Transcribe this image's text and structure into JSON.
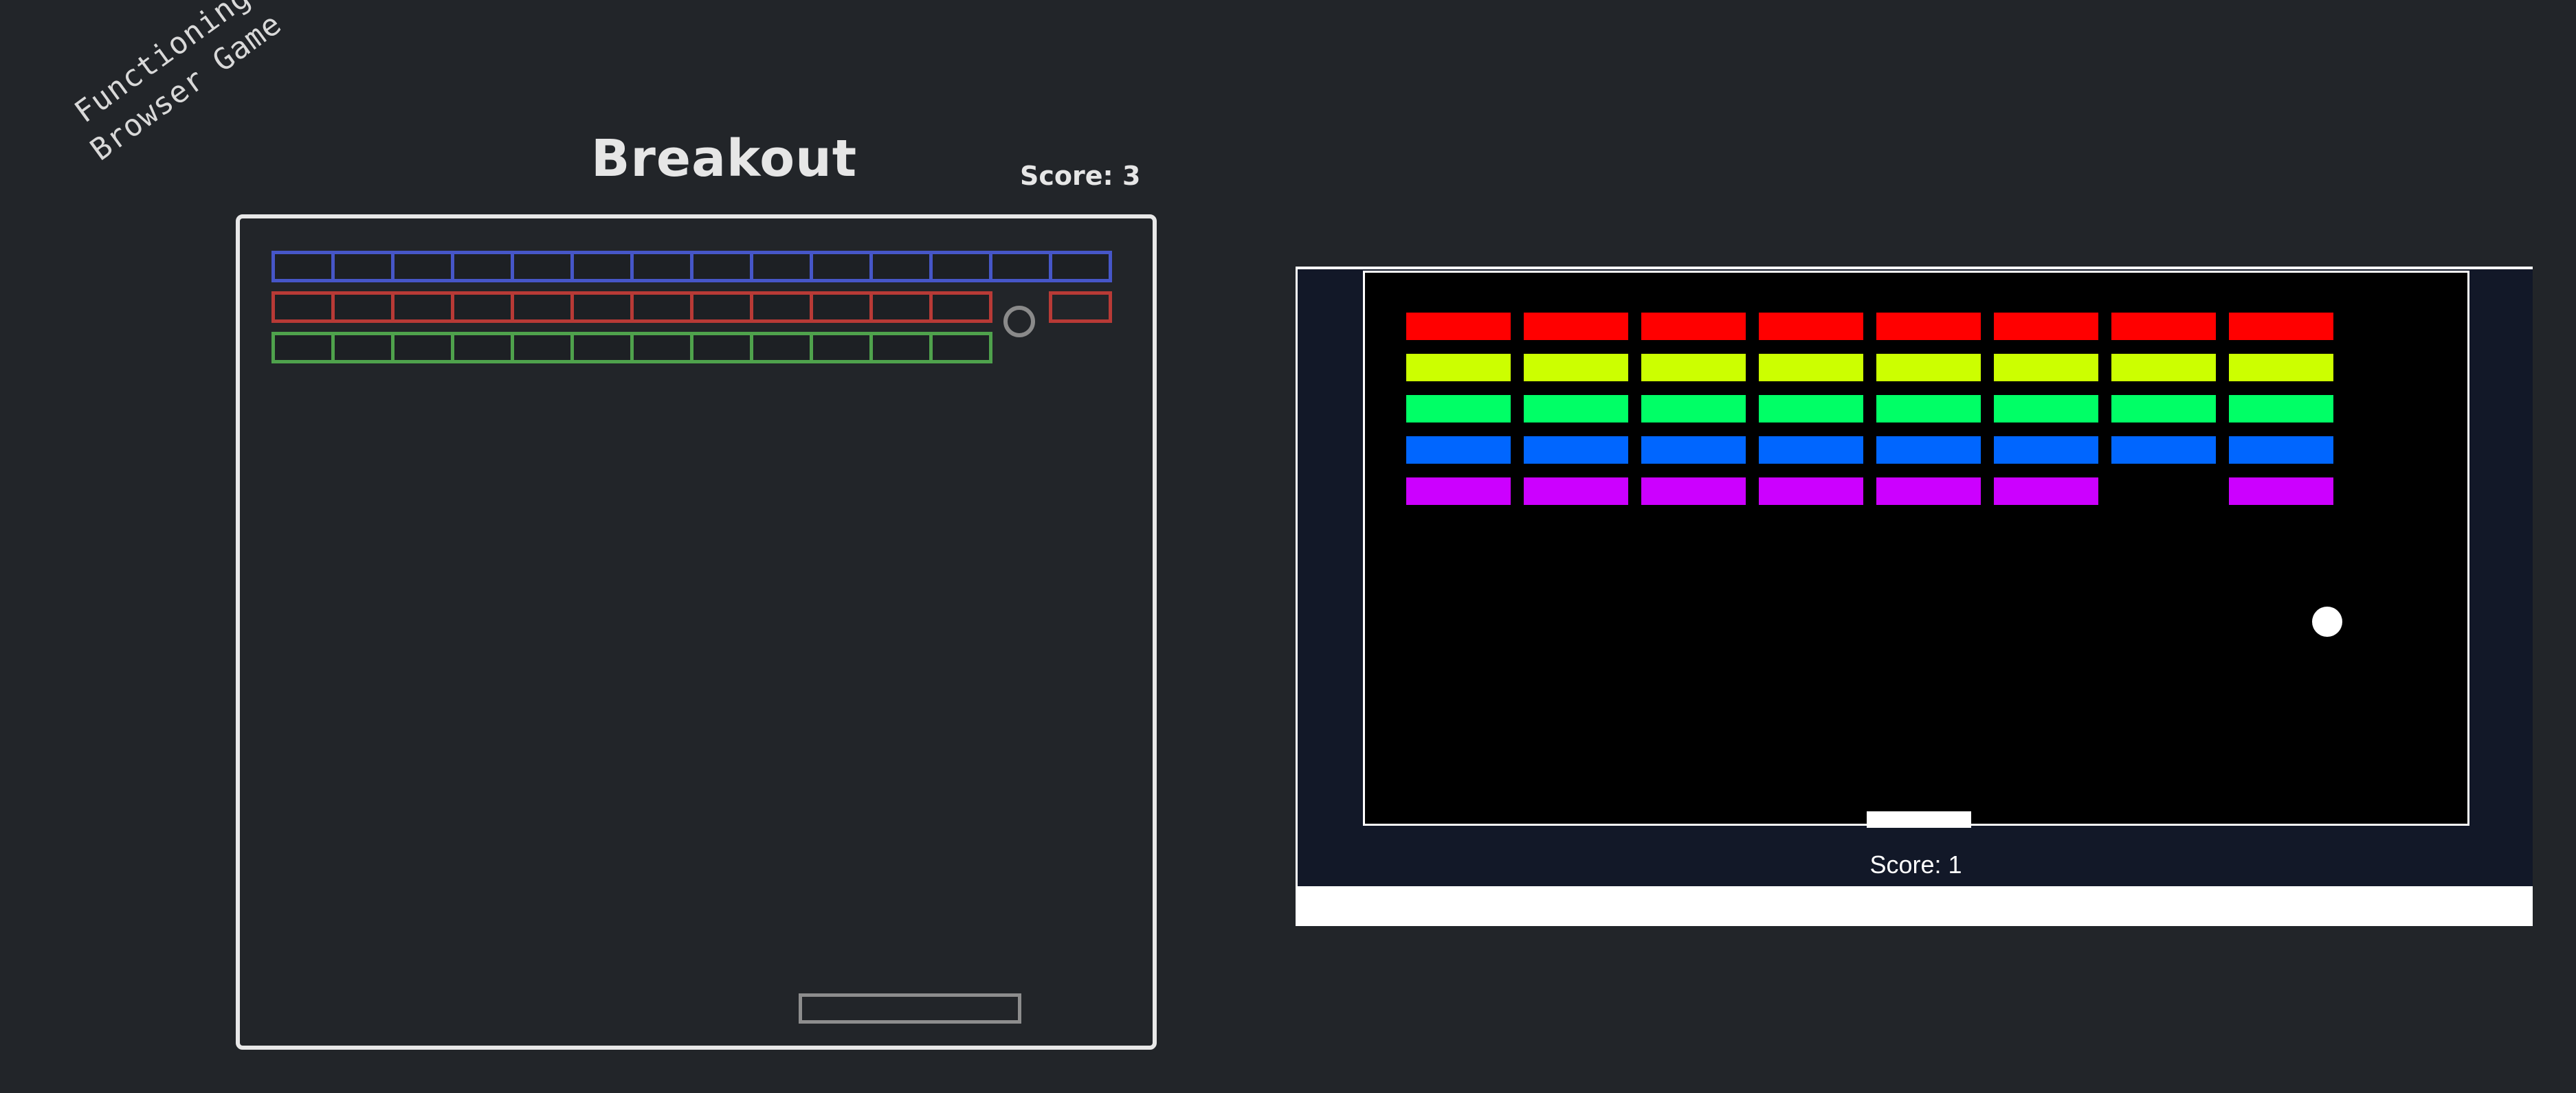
{
  "note": {
    "line1": "Functioning",
    "line2": "Browser Game"
  },
  "sketch": {
    "title": "Breakout",
    "score_label": "Score: 3",
    "colors": {
      "blue": "#4656c8",
      "red": "#b83a36",
      "green": "#4fa24c",
      "ball": "#8a8a8a",
      "paddle": "#8d8d8d",
      "border": "#e8e8e8"
    },
    "rows": [
      {
        "color": "blue",
        "bricks": 14
      },
      {
        "color": "red",
        "bricks": 12,
        "extra_bricks": 1
      },
      {
        "color": "green",
        "bricks": 12
      }
    ]
  },
  "screenshot": {
    "score_label": "Score: 1",
    "colors": {
      "background": "#121828",
      "canvas": "#000000",
      "row1": "#ff0000",
      "row2": "#ccff00",
      "row3": "#00ff66",
      "row4": "#0066ff",
      "row5": "#cc00ff"
    },
    "rows": [
      {
        "color": "row1",
        "present": [
          1,
          1,
          1,
          1,
          1,
          1,
          1,
          1
        ]
      },
      {
        "color": "row2",
        "present": [
          1,
          1,
          1,
          1,
          1,
          1,
          1,
          1
        ]
      },
      {
        "color": "row3",
        "present": [
          1,
          1,
          1,
          1,
          1,
          1,
          1,
          1
        ]
      },
      {
        "color": "row4",
        "present": [
          1,
          1,
          1,
          1,
          1,
          1,
          1,
          1
        ]
      },
      {
        "color": "row5",
        "present": [
          1,
          1,
          1,
          1,
          1,
          1,
          0,
          1
        ]
      }
    ]
  }
}
